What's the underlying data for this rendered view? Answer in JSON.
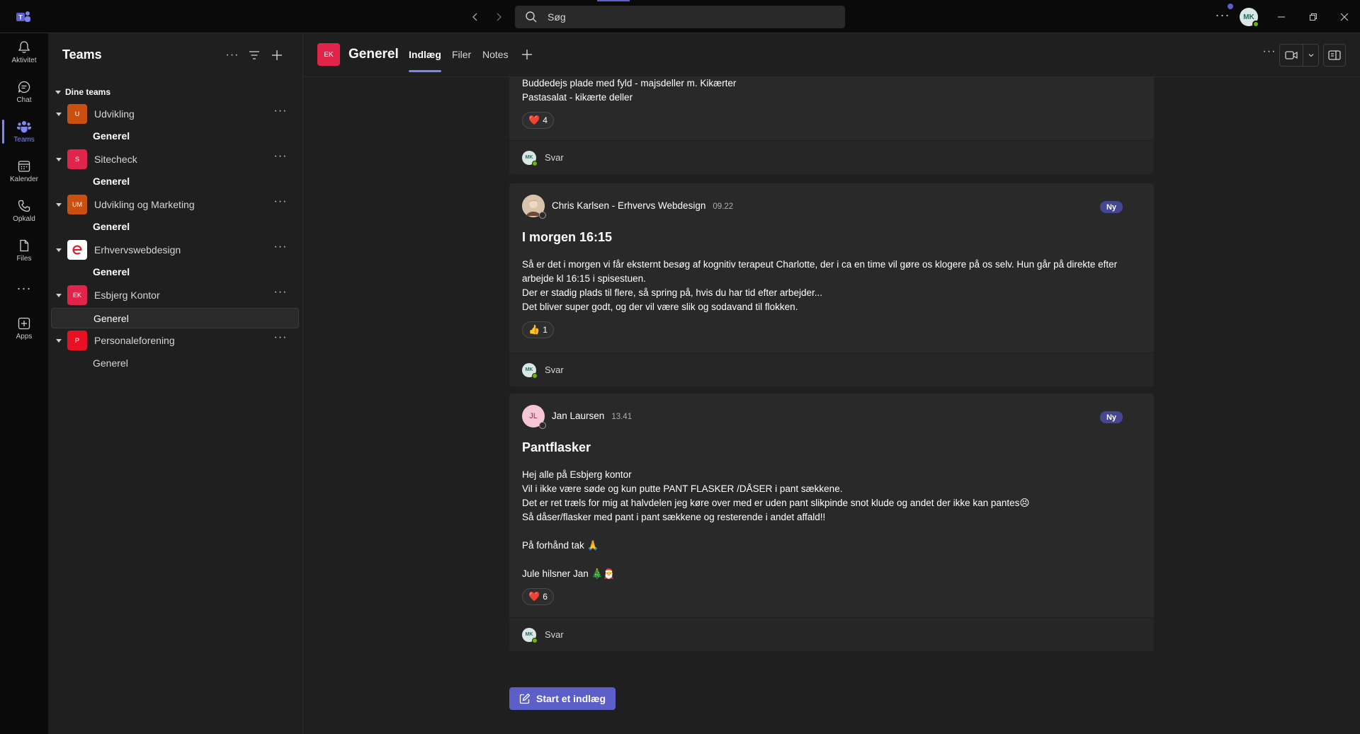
{
  "titlebar": {
    "search_placeholder": "Søg",
    "user_initials": "MK",
    "more_label": "···"
  },
  "rail": {
    "items": [
      {
        "label": "Aktivitet",
        "icon": "bell-icon"
      },
      {
        "label": "Chat",
        "icon": "chat-icon"
      },
      {
        "label": "Teams",
        "icon": "teams-icon",
        "active": true
      },
      {
        "label": "Kalender",
        "icon": "calendar-icon"
      },
      {
        "label": "Opkald",
        "icon": "phone-icon"
      },
      {
        "label": "Files",
        "icon": "file-icon"
      },
      {
        "label": "···",
        "icon": "more-icon"
      },
      {
        "label": "Apps",
        "icon": "apps-icon"
      }
    ]
  },
  "teams_panel": {
    "title": "Teams",
    "section_label": "Dine teams",
    "more_label": "···",
    "teams": [
      {
        "initials": "U",
        "name": "Udvikling",
        "color": "#ca5010",
        "channel": "Generel",
        "channel_style": "bold"
      },
      {
        "initials": "S",
        "name": "Sitecheck",
        "color": "#e0244a",
        "channel": "Generel",
        "channel_style": "bold"
      },
      {
        "initials": "UM",
        "name": "Udvikling og Marketing",
        "color": "#ca5010",
        "channel": "Generel",
        "channel_style": "bold"
      },
      {
        "initials": "e",
        "name": "Erhvervswebdesign",
        "color": "#ffffff",
        "channel": "Generel",
        "channel_style": "bold"
      },
      {
        "initials": "EK",
        "name": "Esbjerg Kontor",
        "color": "#e0244a",
        "channel": "Generel",
        "channel_style": "selected"
      },
      {
        "initials": "P",
        "name": "Personaleforening",
        "color": "#e81123",
        "channel": "Generel",
        "channel_style": "normal"
      }
    ]
  },
  "channel_header": {
    "team_initials": "EK",
    "channel_name": "Generel",
    "tabs": [
      "Indlæg",
      "Filer",
      "Notes"
    ],
    "active_tab": "Indlæg",
    "more_label": "···"
  },
  "feed": {
    "reply_label": "Svar",
    "reply_initials": "MK",
    "new_badge": "Ny",
    "posts": [
      {
        "lines": [
          "Buddedejs plade med fyld - majsdeller m. Kikærter",
          "Pastasalat - kikærte deller"
        ],
        "reaction": {
          "emoji": "❤️",
          "count": "4"
        }
      },
      {
        "author": "Chris Karlsen - Erhvervs Webdesign",
        "time": "09.22",
        "subject": "I morgen 16:15",
        "lines": [
          "Så er det i morgen vi får eksternt besøg af kognitiv terapeut Charlotte, der i ca en time vil gøre os klogere på os selv. Hun går på direkte efter",
          "arbejde kl 16:15 i spisestuen.",
          "Der er stadig plads til flere, så spring på, hvis du har tid efter arbejder...",
          "Det bliver super godt, og der vil være slik og sodavand til flokken."
        ],
        "reaction": {
          "emoji": "👍",
          "count": "1"
        }
      },
      {
        "author": "Jan Laursen",
        "author_initials": "JL",
        "time": "13.41",
        "subject": "Pantflasker",
        "lines": [
          "Hej alle på Esbjerg kontor",
          "Vil i ikke være søde og kun putte PANT FLASKER /DÅSER i pant sækkene.",
          "Det er ret træls for mig at halvdelen jeg køre over med er uden pant slikpinde snot klude og andet der ikke kan pantes😣",
          "Så dåser/flasker med pant i pant sækkene og resterende i andet affald!!",
          "",
          "På forhånd tak 🙏",
          "",
          "Jule hilsner Jan 🎄🎅"
        ],
        "reaction": {
          "emoji": "❤️",
          "count": "6"
        }
      }
    ],
    "start_post_label": "Start et indlæg"
  },
  "colors": {
    "accent": "#5b5fc7",
    "accent_light": "#7f85f5",
    "background": "#1f1f1f",
    "card": "#292929",
    "rail": "#0a0a0a"
  }
}
